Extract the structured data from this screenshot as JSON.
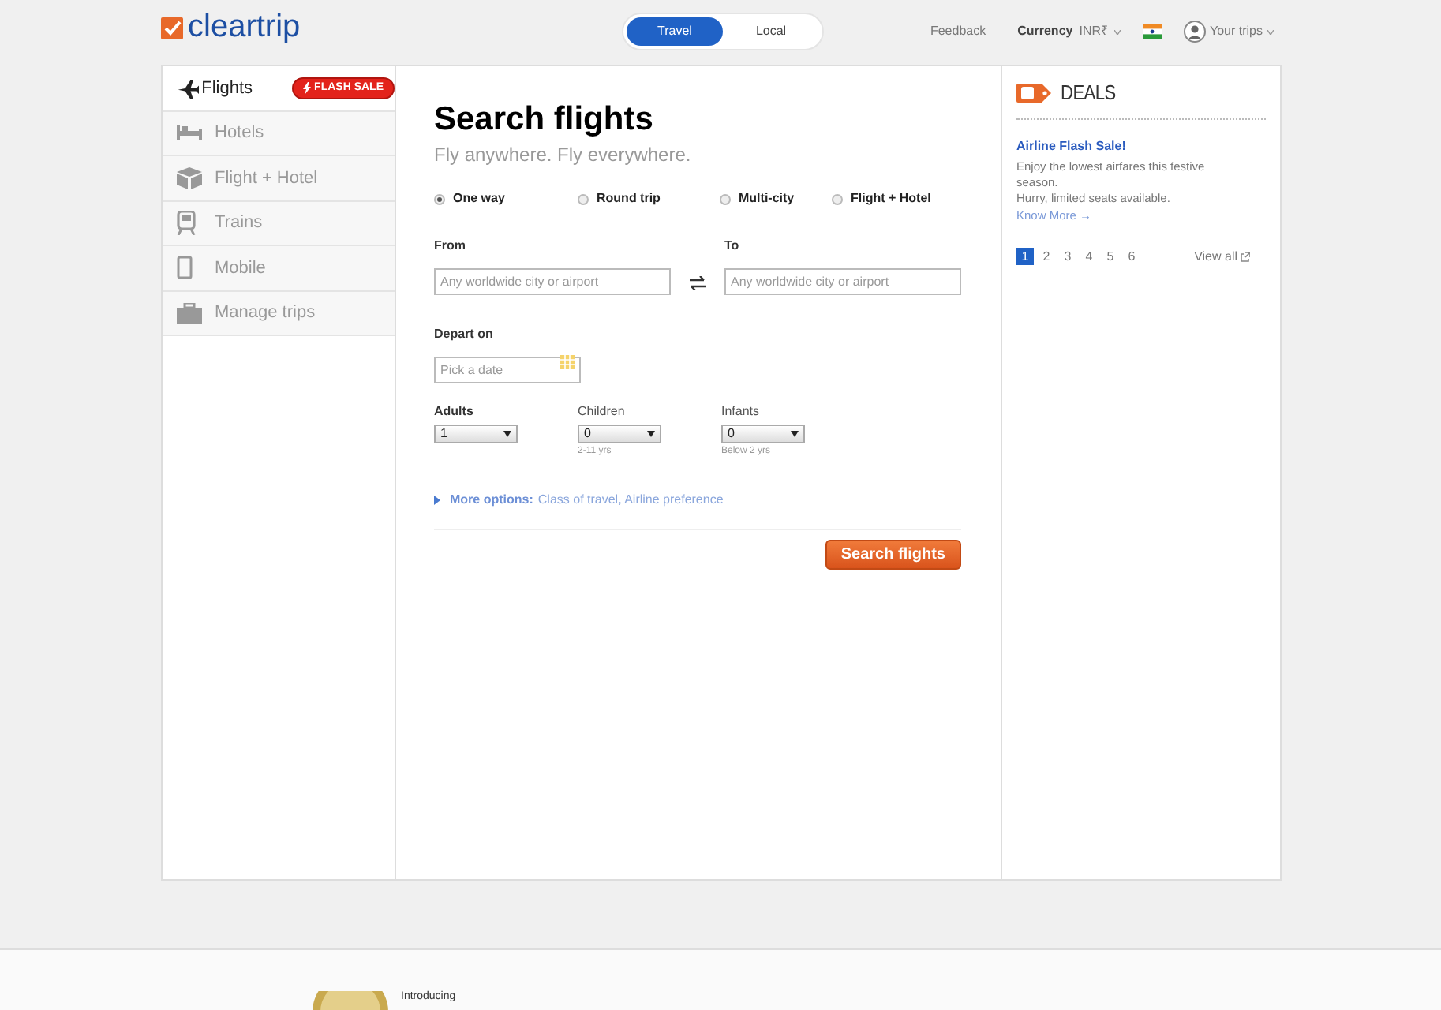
{
  "header": {
    "logo": "cleartrip",
    "mode_tabs": [
      {
        "label": "Travel",
        "selected": true
      },
      {
        "label": "Local",
        "selected": false
      }
    ],
    "feedback": "Feedback",
    "currency_label": "Currency",
    "currency_value": "INR₹",
    "your_trips": "Your trips"
  },
  "sidebar": {
    "items": [
      {
        "label": "Flights",
        "kind": "plane",
        "selected": true,
        "badge": "FLASH SALE"
      },
      {
        "label": "Hotels",
        "kind": "bed",
        "selected": false
      },
      {
        "label": "Flight + Hotel",
        "kind": "package",
        "selected": false
      },
      {
        "label": "Trains",
        "kind": "train",
        "selected": false
      },
      {
        "label": "Mobile",
        "kind": "mobile",
        "selected": false
      },
      {
        "label": "Manage trips",
        "kind": "briefcase",
        "selected": false
      }
    ]
  },
  "search": {
    "title": "Search flights",
    "subtitle": "Fly anywhere. Fly everywhere.",
    "trip_types": [
      {
        "label": "One way",
        "selected": true
      },
      {
        "label": "Round trip",
        "selected": false
      },
      {
        "label": "Multi-city",
        "selected": false
      },
      {
        "label": "Flight + Hotel",
        "selected": false
      }
    ],
    "from": {
      "label": "From",
      "placeholder": "Any worldwide city or airport"
    },
    "to": {
      "label": "To",
      "placeholder": "Any worldwide city or airport"
    },
    "depart": {
      "label": "Depart on",
      "placeholder": "Pick a date"
    },
    "passengers": [
      {
        "label": "Adults",
        "value": "1",
        "bold": true
      },
      {
        "label": "Children",
        "value": "0",
        "hint": "2-11 yrs",
        "bold": false
      },
      {
        "label": "Infants",
        "value": "0",
        "hint": "Below 2 yrs",
        "bold": false
      }
    ],
    "more_options": {
      "label": "More options:",
      "detail": "Class of travel, Airline preference"
    },
    "submit": "Search flights"
  },
  "deals": {
    "title": "DEALS",
    "headline": "Airline Flash Sale!",
    "body": "Enjoy the lowest airfares this festive season.",
    "body_2": "Hurry, limited seats available.",
    "link": "Know More →",
    "pages": [
      {
        "label": "1",
        "selected": true
      },
      {
        "label": "2",
        "selected": false
      },
      {
        "label": "3",
        "selected": false
      },
      {
        "label": "4",
        "selected": false
      },
      {
        "label": "5",
        "selected": false
      },
      {
        "label": "6",
        "selected": false
      }
    ],
    "view_all": "View all"
  },
  "footer": {
    "intro": "Introducing"
  }
}
